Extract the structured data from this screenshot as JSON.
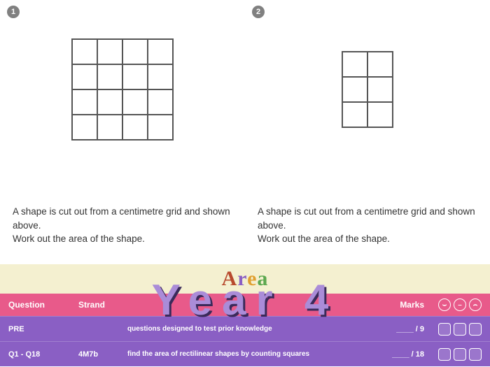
{
  "q1": {
    "num": "1",
    "grid": {
      "cols": 4,
      "rows": 4
    },
    "text": "A shape is cut out from a centimetre grid and shown above.\nWork out the area of the shape."
  },
  "q2": {
    "num": "2",
    "grid": {
      "cols": 2,
      "rows": 3
    },
    "text": "A shape is cut out from a centimetre grid and shown above.\nWork out the area of the shape."
  },
  "banner": {
    "title": "Area"
  },
  "overlay": {
    "year": "Year 4"
  },
  "table": {
    "headers": {
      "question": "Question",
      "strand": "Strand",
      "marks": "Marks"
    },
    "rows": [
      {
        "q": "PRE",
        "strand": "",
        "desc": "questions designed to test prior knowledge",
        "marks": "____ / 9"
      },
      {
        "q": "Q1 - Q18",
        "strand": "4M7b",
        "desc": "find the area of rectilinear shapes by counting squares",
        "marks": "____ / 18"
      }
    ]
  }
}
